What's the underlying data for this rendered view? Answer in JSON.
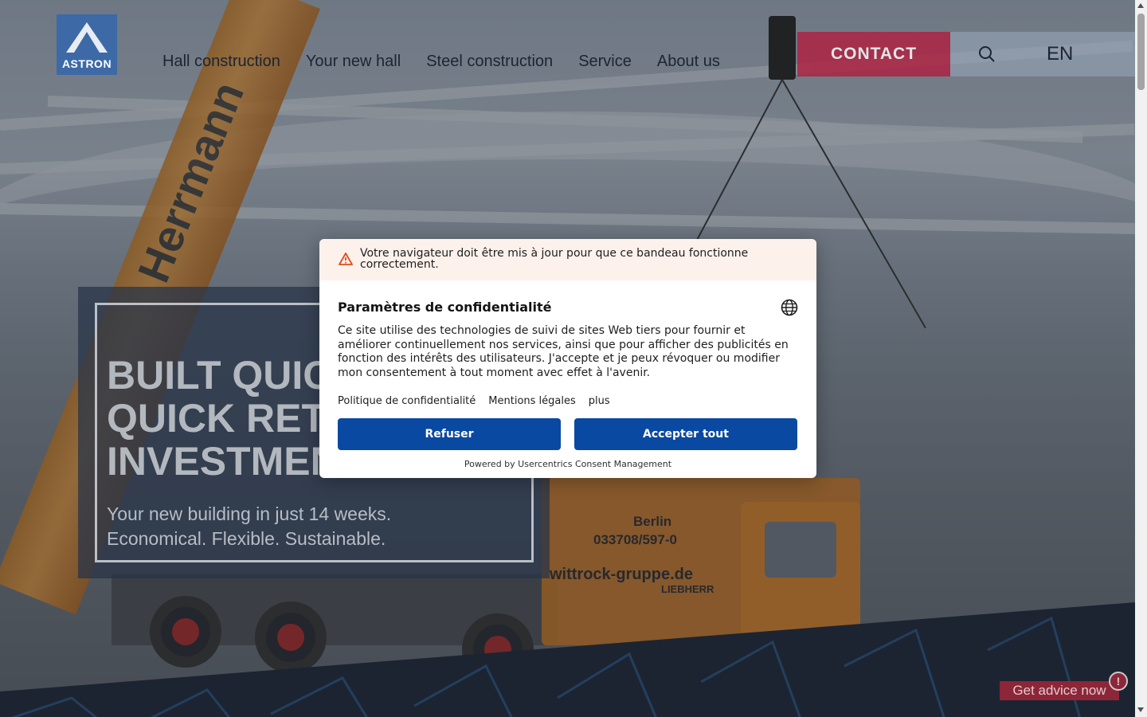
{
  "brand": {
    "logo_text": "ASTRON",
    "logo_color": "#3d6aa6",
    "accent": "#b01e3e"
  },
  "header": {
    "nav": [
      {
        "label": "Hall construction"
      },
      {
        "label": "Your new hall"
      },
      {
        "label": "Steel construction"
      },
      {
        "label": "Service"
      },
      {
        "label": "About us"
      }
    ],
    "contact_label": "CONTACT",
    "search_icon": "search-icon",
    "language": "EN"
  },
  "hero": {
    "title": "BUILT QUICK\nQUICK RETURN ON\nINVESTMENT",
    "subtitle": "Your new building in just 14 weeks.\nEconomical. Flexible. Sustainable.",
    "photo_text": {
      "crane": "Herrmann",
      "truck_city": "Berlin",
      "truck_phone": "033708/597-0",
      "truck_web": "wittrock-gruppe.de",
      "truck_brand": "LIEBHERR"
    }
  },
  "advice": {
    "label": "Get advice now",
    "alert_glyph": "!"
  },
  "consent": {
    "warning": "Votre navigateur doit être mis à jour pour que ce bandeau fonctionne correctement.",
    "title": "Paramètres de confidentialité",
    "body": "Ce site utilise des technologies de suivi de sites Web tiers pour fournir et améliorer continuellement nos services, ainsi que pour afficher des publicités en fonction des intérêts des utilisateurs. J'accepte et je peux révoquer ou modifier mon consentement à tout moment avec effet à l'avenir.",
    "links": [
      "Politique de confidentialité",
      "Mentions légales",
      "plus"
    ],
    "refuse_label": "Refuser",
    "accept_label": "Accepter tout",
    "powered_by": "Powered by Usercentrics Consent Management",
    "button_color": "#0a49a1"
  }
}
